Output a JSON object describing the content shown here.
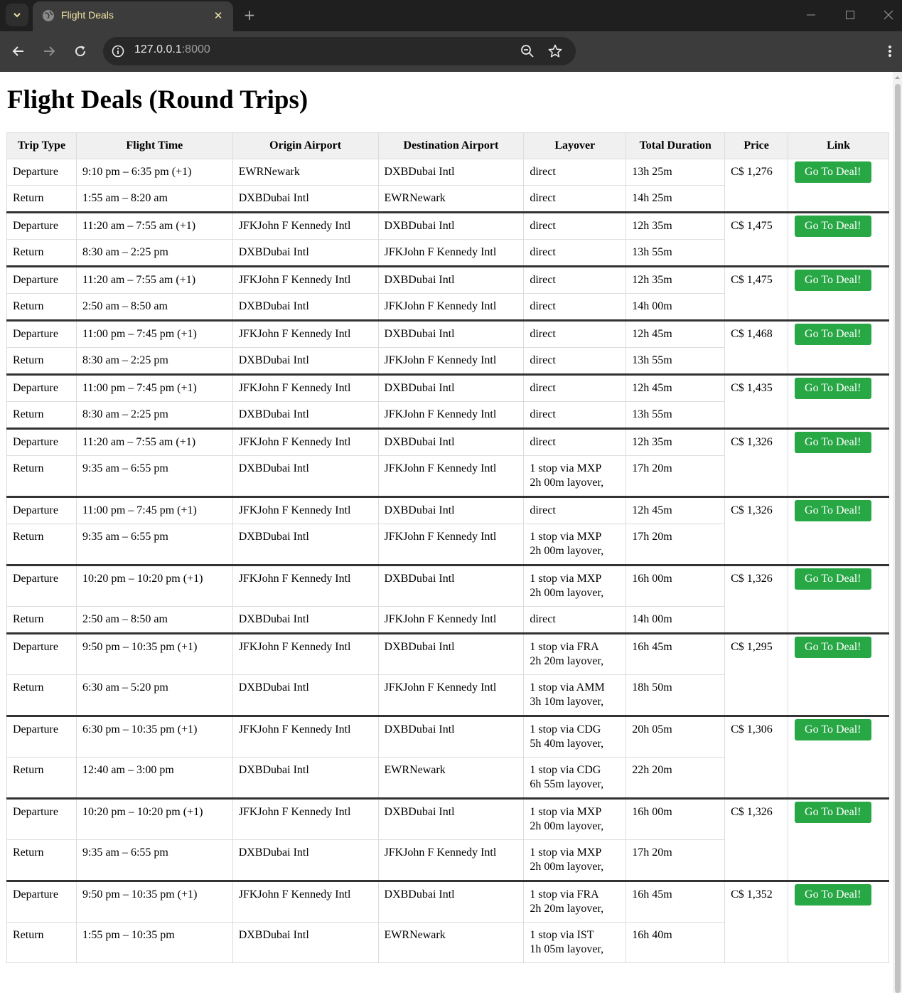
{
  "browser": {
    "tab_title": "Flight Deals",
    "url_host": "127.0.0.1",
    "url_port": ":8000"
  },
  "page": {
    "title": "Flight Deals (Round Trips)"
  },
  "table": {
    "headers": [
      "Trip Type",
      "Flight Time",
      "Origin Airport",
      "Destination Airport",
      "Layover",
      "Total Duration",
      "Price",
      "Link"
    ],
    "button_label": "Go To Deal!",
    "deals": [
      {
        "price": "C$ 1,276",
        "legs": [
          {
            "type": "Departure",
            "time": "9:10 pm – 6:35 pm (+1)",
            "origin": "EWRNewark",
            "dest": "DXBDubai Intl",
            "layover": "direct",
            "duration": "13h 25m"
          },
          {
            "type": "Return",
            "time": "1:55 am – 8:20 am",
            "origin": "DXBDubai Intl",
            "dest": "EWRNewark",
            "layover": "direct",
            "duration": "14h 25m"
          }
        ]
      },
      {
        "price": "C$ 1,475",
        "legs": [
          {
            "type": "Departure",
            "time": "11:20 am – 7:55 am (+1)",
            "origin": "JFKJohn F Kennedy Intl",
            "dest": "DXBDubai Intl",
            "layover": "direct",
            "duration": "12h 35m"
          },
          {
            "type": "Return",
            "time": "8:30 am – 2:25 pm",
            "origin": "DXBDubai Intl",
            "dest": "JFKJohn F Kennedy Intl",
            "layover": "direct",
            "duration": "13h 55m"
          }
        ]
      },
      {
        "price": "C$ 1,475",
        "legs": [
          {
            "type": "Departure",
            "time": "11:20 am – 7:55 am (+1)",
            "origin": "JFKJohn F Kennedy Intl",
            "dest": "DXBDubai Intl",
            "layover": "direct",
            "duration": "12h 35m"
          },
          {
            "type": "Return",
            "time": "2:50 am – 8:50 am",
            "origin": "DXBDubai Intl",
            "dest": "JFKJohn F Kennedy Intl",
            "layover": "direct",
            "duration": "14h 00m"
          }
        ]
      },
      {
        "price": "C$ 1,468",
        "legs": [
          {
            "type": "Departure",
            "time": "11:00 pm – 7:45 pm (+1)",
            "origin": "JFKJohn F Kennedy Intl",
            "dest": "DXBDubai Intl",
            "layover": "direct",
            "duration": "12h 45m"
          },
          {
            "type": "Return",
            "time": "8:30 am – 2:25 pm",
            "origin": "DXBDubai Intl",
            "dest": "JFKJohn F Kennedy Intl",
            "layover": "direct",
            "duration": "13h 55m"
          }
        ]
      },
      {
        "price": "C$ 1,435",
        "legs": [
          {
            "type": "Departure",
            "time": "11:00 pm – 7:45 pm (+1)",
            "origin": "JFKJohn F Kennedy Intl",
            "dest": "DXBDubai Intl",
            "layover": "direct",
            "duration": "12h 45m"
          },
          {
            "type": "Return",
            "time": "8:30 am – 2:25 pm",
            "origin": "DXBDubai Intl",
            "dest": "JFKJohn F Kennedy Intl",
            "layover": "direct",
            "duration": "13h 55m"
          }
        ]
      },
      {
        "price": "C$ 1,326",
        "legs": [
          {
            "type": "Departure",
            "time": "11:20 am – 7:55 am (+1)",
            "origin": "JFKJohn F Kennedy Intl",
            "dest": "DXBDubai Intl",
            "layover": "direct",
            "duration": "12h 35m"
          },
          {
            "type": "Return",
            "time": "9:35 am – 6:55 pm",
            "origin": "DXBDubai Intl",
            "dest": "JFKJohn F Kennedy Intl",
            "layover": "1 stop via MXP\n2h 00m layover,",
            "duration": "17h 20m"
          }
        ]
      },
      {
        "price": "C$ 1,326",
        "legs": [
          {
            "type": "Departure",
            "time": "11:00 pm – 7:45 pm (+1)",
            "origin": "JFKJohn F Kennedy Intl",
            "dest": "DXBDubai Intl",
            "layover": "direct",
            "duration": "12h 45m"
          },
          {
            "type": "Return",
            "time": "9:35 am – 6:55 pm",
            "origin": "DXBDubai Intl",
            "dest": "JFKJohn F Kennedy Intl",
            "layover": "1 stop via MXP\n2h 00m layover,",
            "duration": "17h 20m"
          }
        ]
      },
      {
        "price": "C$ 1,326",
        "legs": [
          {
            "type": "Departure",
            "time": "10:20 pm – 10:20 pm (+1)",
            "origin": "JFKJohn F Kennedy Intl",
            "dest": "DXBDubai Intl",
            "layover": "1 stop via MXP\n2h 00m layover,",
            "duration": "16h 00m"
          },
          {
            "type": "Return",
            "time": "2:50 am – 8:50 am",
            "origin": "DXBDubai Intl",
            "dest": "JFKJohn F Kennedy Intl",
            "layover": "direct",
            "duration": "14h 00m"
          }
        ]
      },
      {
        "price": "C$ 1,295",
        "legs": [
          {
            "type": "Departure",
            "time": "9:50 pm – 10:35 pm (+1)",
            "origin": "JFKJohn F Kennedy Intl",
            "dest": "DXBDubai Intl",
            "layover": "1 stop via FRA\n2h 20m layover,",
            "duration": "16h 45m"
          },
          {
            "type": "Return",
            "time": "6:30 am – 5:20 pm",
            "origin": "DXBDubai Intl",
            "dest": "JFKJohn F Kennedy Intl",
            "layover": "1 stop via AMM\n3h 10m layover,",
            "duration": "18h 50m"
          }
        ]
      },
      {
        "price": "C$ 1,306",
        "legs": [
          {
            "type": "Departure",
            "time": "6:30 pm – 10:35 pm (+1)",
            "origin": "JFKJohn F Kennedy Intl",
            "dest": "DXBDubai Intl",
            "layover": "1 stop via CDG\n5h 40m layover,",
            "duration": "20h 05m"
          },
          {
            "type": "Return",
            "time": "12:40 am – 3:00 pm",
            "origin": "DXBDubai Intl",
            "dest": "EWRNewark",
            "layover": "1 stop via CDG\n6h 55m layover,",
            "duration": "22h 20m"
          }
        ]
      },
      {
        "price": "C$ 1,326",
        "legs": [
          {
            "type": "Departure",
            "time": "10:20 pm – 10:20 pm (+1)",
            "origin": "JFKJohn F Kennedy Intl",
            "dest": "DXBDubai Intl",
            "layover": "1 stop via MXP\n2h 00m layover,",
            "duration": "16h 00m"
          },
          {
            "type": "Return",
            "time": "9:35 am – 6:55 pm",
            "origin": "DXBDubai Intl",
            "dest": "JFKJohn F Kennedy Intl",
            "layover": "1 stop via MXP\n2h 00m layover,",
            "duration": "17h 20m"
          }
        ]
      },
      {
        "price": "C$ 1,352",
        "legs": [
          {
            "type": "Departure",
            "time": "9:50 pm – 10:35 pm (+1)",
            "origin": "JFKJohn F Kennedy Intl",
            "dest": "DXBDubai Intl",
            "layover": "1 stop via FRA\n2h 20m layover,",
            "duration": "16h 45m"
          },
          {
            "type": "Return",
            "time": "1:55 pm – 10:35 pm",
            "origin": "DXBDubai Intl",
            "dest": "EWRNewark",
            "layover": "1 stop via IST\n1h 05m layover,",
            "duration": "16h 40m"
          }
        ]
      }
    ]
  }
}
